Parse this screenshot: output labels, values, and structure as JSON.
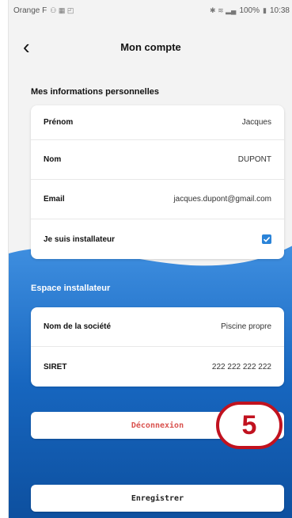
{
  "status_bar": {
    "carrier": "Orange F",
    "battery": "100%",
    "time": "10:38"
  },
  "header": {
    "title": "Mon compte"
  },
  "personal": {
    "section_title": "Mes informations personnelles",
    "fields": [
      {
        "label": "Prénom",
        "value": "Jacques"
      },
      {
        "label": "Nom",
        "value": "DUPONT"
      },
      {
        "label": "Email",
        "value": "jacques.dupont@gmail.com"
      }
    ],
    "installer_label": "Je suis installateur",
    "installer_checked": true
  },
  "installer_space": {
    "section_title": "Espace installateur",
    "fields": [
      {
        "label": "Nom de la société",
        "value": "Piscine propre"
      },
      {
        "label": "SIRET",
        "value": "222 222 222 222"
      }
    ]
  },
  "actions": {
    "logout_label": "Déconnexion",
    "save_label": "Enregistrer"
  },
  "annotation": {
    "number": "5"
  },
  "colors": {
    "accent_blue": "#1d6fc6",
    "logout_red": "#d9534f",
    "annotation_red": "#c1121f"
  }
}
